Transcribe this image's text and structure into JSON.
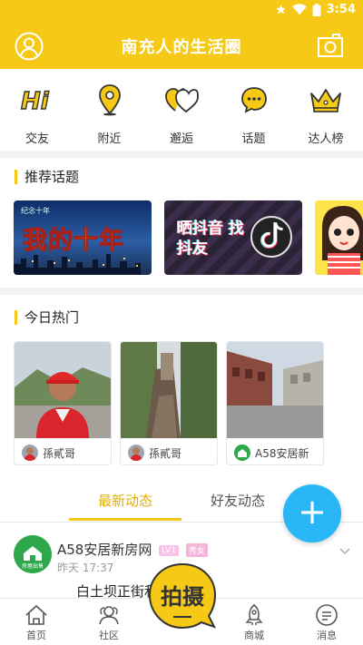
{
  "status": {
    "time": "3:54"
  },
  "header": {
    "title": "南充人的生活圈"
  },
  "categories": [
    {
      "label": "交友",
      "icon": "hi-icon"
    },
    {
      "label": "附近",
      "icon": "location-pin-icon"
    },
    {
      "label": "邂逅",
      "icon": "hearts-icon"
    },
    {
      "label": "话题",
      "icon": "chat-bubble-icon"
    },
    {
      "label": "达人榜",
      "icon": "crown-icon"
    }
  ],
  "recommended": {
    "title": "推荐话题",
    "topics": [
      {
        "caption": "我的十年",
        "tag": "纪念十年"
      },
      {
        "caption": "晒抖音 找抖友"
      }
    ]
  },
  "hot": {
    "title": "今日热门",
    "items": [
      {
        "user": "孫貳哥"
      },
      {
        "user": "孫貳哥"
      },
      {
        "user": "A58安居新"
      }
    ]
  },
  "tabs": {
    "latest": "最新动态",
    "friends": "好友动态"
  },
  "post": {
    "name": "A58安居新房网",
    "level": "LV1",
    "tag": "秀女",
    "time": "昨天 17:37",
    "text": "白土坝正街和",
    "avatar_caption": "房屋出售"
  },
  "shoot": {
    "label": "拍摄"
  },
  "nav": {
    "home": "首页",
    "community": "社区",
    "mall": "商城",
    "messages": "消息"
  },
  "colors": {
    "brand": "#f5c916",
    "accent": "#29b6f6"
  }
}
